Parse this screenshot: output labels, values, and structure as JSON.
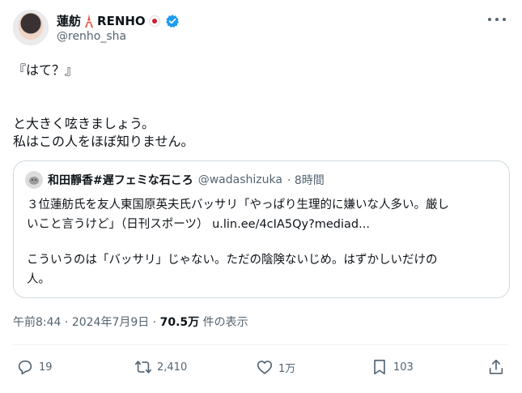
{
  "author": {
    "display_name": "蓮舫",
    "display_name_suffix": "RENHO",
    "handle": "@renho_sha",
    "verified_color": "#1d9bf0"
  },
  "tweet": {
    "line1": "『はて？』",
    "line2": "と大きく呟きましょう。",
    "line3": "私はこの人をほぼ知りません。"
  },
  "quote": {
    "name": "和田靜香#遅フェミな石ころ",
    "handle": "@wadashizuka",
    "time": "· 8時間",
    "line1": "３位蓮舫氏を友人東国原英夫氏バッサリ「やっぱり生理的に嫌いな人多い。厳し",
    "line2": "いこと言うけど」（日刊スポーツ） u.lin.ee/4cIA5Qy?mediad...",
    "line3": "こういうのは「バッサリ」じゃない。ただの陰険ないじめ。はずかしいだけの",
    "line4": "人。"
  },
  "meta": {
    "time": "午前8:44",
    "sep1": "·",
    "date": "2024年7月9日",
    "sep2": "·",
    "views": "70.5万",
    "views_label": "件の表示"
  },
  "actions": {
    "reply_count": "19",
    "retweet_count": "2,410",
    "like_count": "1万",
    "bookmark_count": "103"
  },
  "icons": {
    "reply": "reply-icon",
    "retweet": "retweet-icon",
    "like": "heart-icon",
    "bookmark": "bookmark-icon",
    "share": "share-icon"
  }
}
